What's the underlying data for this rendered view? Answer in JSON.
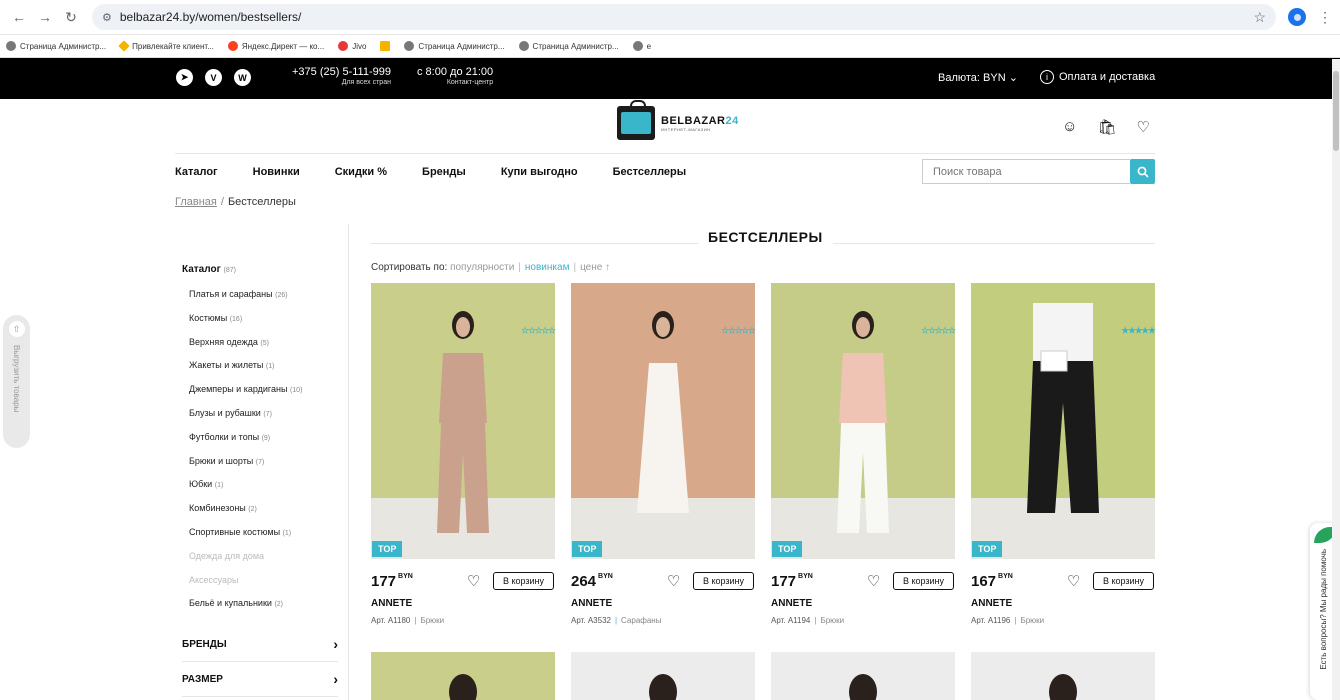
{
  "browser": {
    "url": "belbazar24.by/women/bestsellers/",
    "bookmarks": [
      {
        "label": "Страница Администр...",
        "icon": "globe-icon"
      },
      {
        "label": "Привлекайте клиент...",
        "icon": "google-ads-icon"
      },
      {
        "label": "Яндекс.Директ — ко...",
        "icon": "yandex-icon"
      },
      {
        "label": "Jivo",
        "icon": "jivo-icon"
      },
      {
        "label": "",
        "icon": "mail-icon"
      },
      {
        "label": "Страница Администр...",
        "icon": "globe-icon"
      },
      {
        "label": "Страница Администр...",
        "icon": "globe-icon"
      },
      {
        "label": "e",
        "icon": "globe-icon"
      }
    ]
  },
  "topbar": {
    "phone": "+375 (25) 5-111-999",
    "phone_note": "Для всех стран",
    "hours": "с 8:00 до 21:00",
    "hours_note": "Контакт-центр",
    "currency": "Валюта: BYN",
    "delivery": "Оплата и доставка"
  },
  "header": {
    "logo_text": "BELBAZAR",
    "logo_num": "24",
    "logo_sub": "ИНТЕРНЕТ-МАГАЗИН"
  },
  "nav": {
    "items": [
      "Каталог",
      "Новинки",
      "Скидки %",
      "Бренды",
      "Купи выгодно",
      "Бестселлеры"
    ],
    "search_placeholder": "Поиск товара"
  },
  "breadcrumb": {
    "home": "Главная",
    "sep": "/",
    "current": "Бестселлеры"
  },
  "sidebar": {
    "catalog_title": "Каталог",
    "catalog_count": "(87)",
    "categories": [
      {
        "name": "Платья и сарафаны",
        "count": "(26)",
        "muted": false
      },
      {
        "name": "Костюмы",
        "count": "(16)",
        "muted": false
      },
      {
        "name": "Верхняя одежда",
        "count": "(5)",
        "muted": false
      },
      {
        "name": "Жакеты и жилеты",
        "count": "(1)",
        "muted": false
      },
      {
        "name": "Джемперы и кардиганы",
        "count": "(10)",
        "muted": false
      },
      {
        "name": "Блузы и рубашки",
        "count": "(7)",
        "muted": false
      },
      {
        "name": "Футболки и топы",
        "count": "(9)",
        "muted": false
      },
      {
        "name": "Брюки и шорты",
        "count": "(7)",
        "muted": false
      },
      {
        "name": "Юбки",
        "count": "(1)",
        "muted": false
      },
      {
        "name": "Комбинезоны",
        "count": "(2)",
        "muted": false
      },
      {
        "name": "Спортивные костюмы",
        "count": "(1)",
        "muted": false
      },
      {
        "name": "Одежда для дома",
        "count": "",
        "muted": true
      },
      {
        "name": "Аксессуары",
        "count": "",
        "muted": true
      },
      {
        "name": "Бельё и купальники",
        "count": "(2)",
        "muted": false
      }
    ],
    "filters": [
      "БРЕНДЫ",
      "РАЗМЕР"
    ],
    "upload_tab": "Выгрузить товары"
  },
  "main": {
    "title": "БЕСТСЕЛЛЕРЫ",
    "sort_label": "Сортировать по:",
    "sort_options": [
      "популярности",
      "новинкам",
      "цене ↑"
    ],
    "sort_active_index": 1,
    "badge": "TOP",
    "currency": "BYN",
    "cart_label": "В корзину",
    "products": [
      {
        "price": "177",
        "brand": "ANNETE",
        "art": "Арт. A1180",
        "category": "Брюки",
        "rating": 0,
        "bg": "#c9ce8a",
        "outfit": "#c9a18d"
      },
      {
        "price": "264",
        "brand": "ANNETE",
        "art": "Арт. A3532",
        "category": "Сарафаны",
        "rating": 0,
        "bg": "#d8a88a",
        "outfit": "#f7f3ee"
      },
      {
        "price": "177",
        "brand": "ANNETE",
        "art": "Арт. A1194",
        "category": "Брюки",
        "rating": 0,
        "bg": "#c4cc88",
        "outfit": "#efc4b4"
      },
      {
        "price": "167",
        "brand": "ANNETE",
        "art": "Арт. A1196",
        "category": "Брюки",
        "rating": 5,
        "bg": "#c3cd7e",
        "outfit": "#1a1a1a"
      }
    ]
  },
  "chat": {
    "label": "Есть вопросы? Мы рады помочь"
  },
  "colors": {
    "accent": "#39b6c9",
    "topbar": "#000000"
  }
}
